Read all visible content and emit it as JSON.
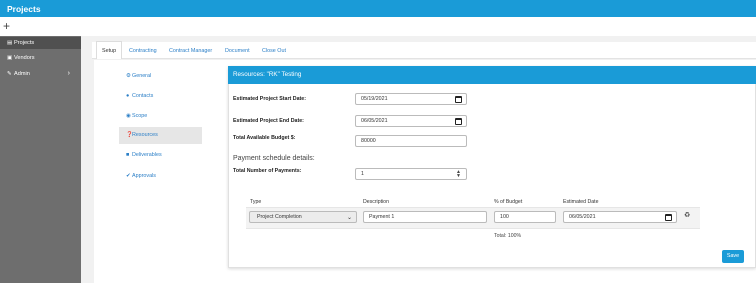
{
  "app": {
    "title": "Projects",
    "add_symbol": "+"
  },
  "sidebar": {
    "items": [
      {
        "label": "Projects",
        "icon": "file-icon"
      },
      {
        "label": "Vendors",
        "icon": "vendor-icon"
      },
      {
        "label": "Admin",
        "icon": "wrench-icon",
        "chevron": "›"
      }
    ]
  },
  "tabs": [
    "Setup",
    "Contracting",
    "Contract Manager",
    "Document",
    "Close Out"
  ],
  "subnav": [
    {
      "label": "General",
      "icon": "gear-icon"
    },
    {
      "label": "Contacts",
      "icon": "user-icon"
    },
    {
      "label": "Scope",
      "icon": "target-icon"
    },
    {
      "label": "Resources",
      "icon": "question-icon"
    },
    {
      "label": "Deliverables",
      "icon": "document-icon"
    },
    {
      "label": "Approvals",
      "icon": "check-icon"
    }
  ],
  "card": {
    "header": "Resources: \"RK\" Testing",
    "start_date_label": "Estimated Project Start Date:",
    "start_date_value": "05/19/2021",
    "end_date_label": "Estimated Project End Date:",
    "end_date_value": "06/05/2021",
    "budget_label": "Total Available Budget $:",
    "budget_value": "80000",
    "payment_section_title": "Payment schedule details:",
    "num_payments_label": "Total Number of Payments:",
    "num_payments_value": "1",
    "table": {
      "headers": [
        "Type",
        "Description",
        "% of Budget",
        "Estimated Date"
      ],
      "rows": [
        {
          "type": "Project Completion",
          "description": "Payment 1",
          "percent": "100",
          "date": "06/05/2021"
        }
      ],
      "total": "Total: 100%"
    },
    "save_label": "Save"
  },
  "colors": {
    "accent": "#1a9bd7",
    "sidebar": "#6e6e6e",
    "link": "#2b7fc7"
  }
}
